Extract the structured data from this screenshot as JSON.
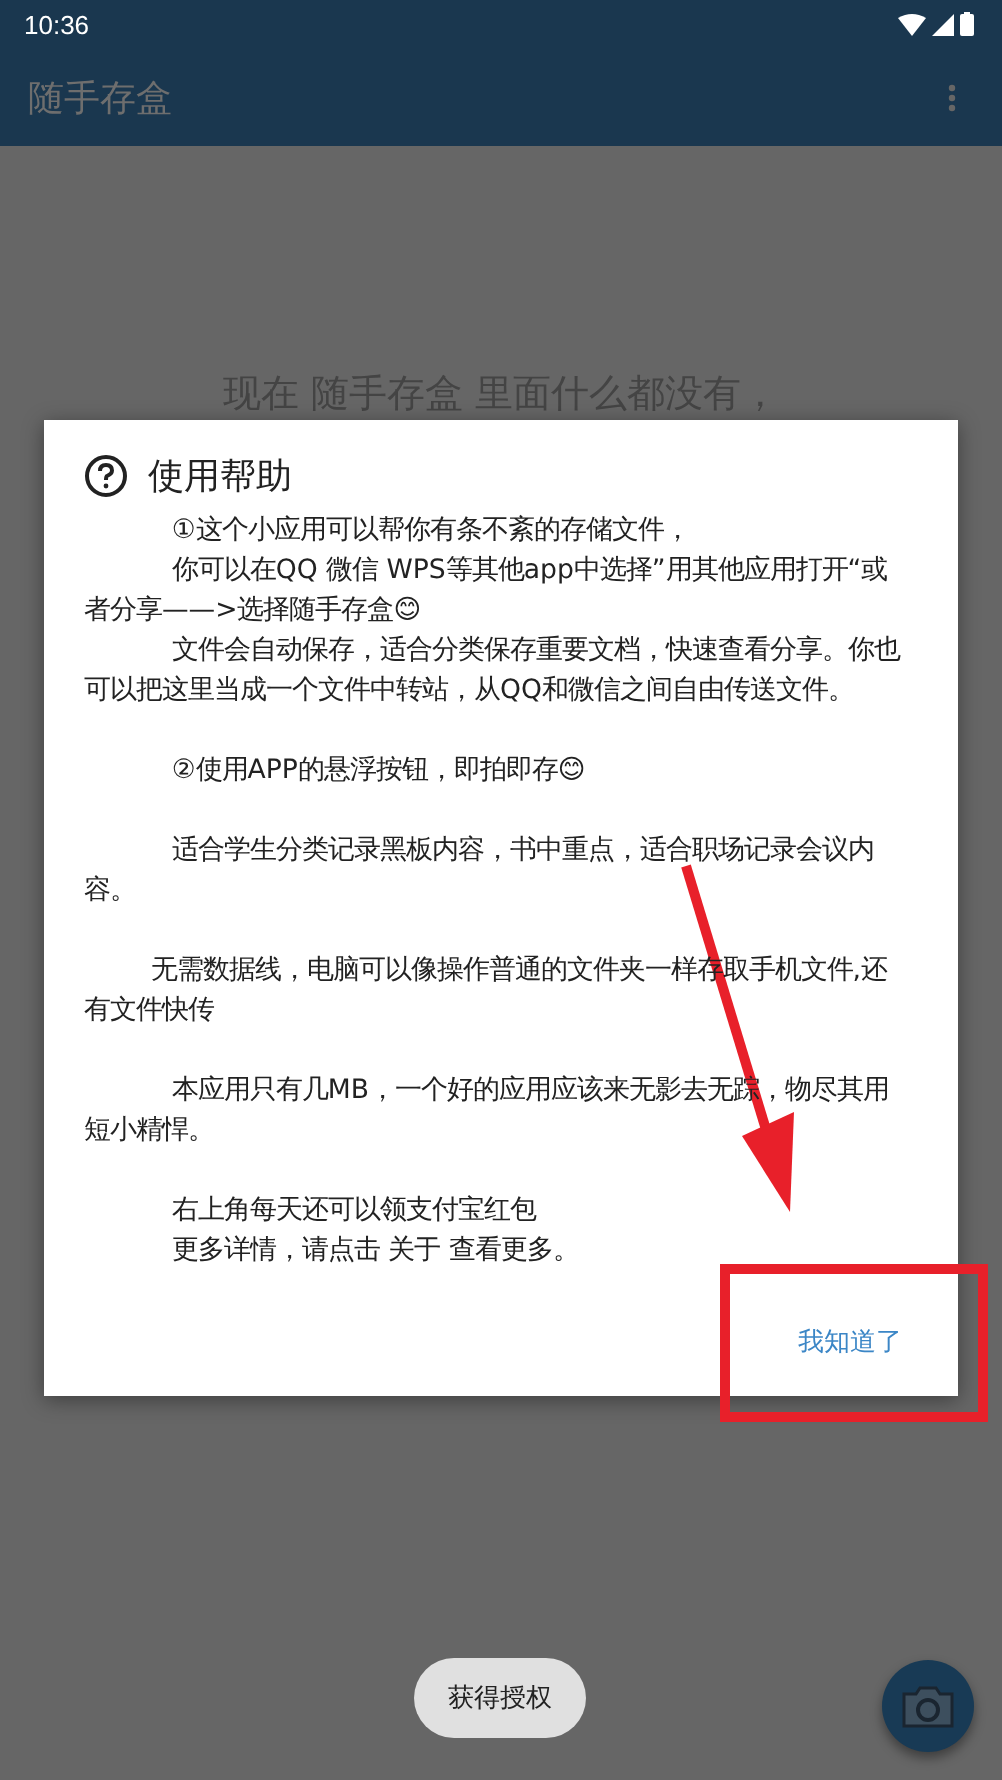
{
  "status_bar": {
    "time": "10:36"
  },
  "app_bar": {
    "title": "随手存盒"
  },
  "empty_message": "现在 随手存盒 里面什么都没有，",
  "dialog": {
    "title": "使用帮助",
    "blocks": [
      [
        {
          "kind": "indent",
          "text": "①这个小应用可以帮你有条不紊的存储文件，"
        },
        {
          "kind": "indent",
          "text": "你可以在QQ 微信 WPS等其他app中选择”用其他应用打开“或者分享——>选择随手存盒😊"
        },
        {
          "kind": "indent",
          "text": "文件会自动保存，适合分类保存重要文档，快速查看分享。你也可以把这里当成一个文件中转站，从QQ和微信之间自由传送文件。"
        }
      ],
      [
        {
          "kind": "indent",
          "text": "②使用APP的悬浮按钮，即拍即存😊"
        }
      ],
      [
        {
          "kind": "indent",
          "text": "适合学生分类记录黑板内容，书中重点，适合职场记录会议内容。"
        }
      ],
      [
        {
          "kind": "narrow",
          "text": "无需数据线，电脑可以像操作普通的文件夹一样存取手机文件,还有文件快传"
        }
      ],
      [
        {
          "kind": "indent",
          "text": "本应用只有几MB，一个好的应用应该来无影去无踪，物尽其用短小精悍。"
        }
      ],
      [
        {
          "kind": "indent",
          "text": "右上角每天还可以领支付宝红包"
        },
        {
          "kind": "indent",
          "text": "更多详情，请点击 关于 查看更多。"
        }
      ]
    ],
    "button": "我知道了"
  },
  "toast": "获得授权"
}
